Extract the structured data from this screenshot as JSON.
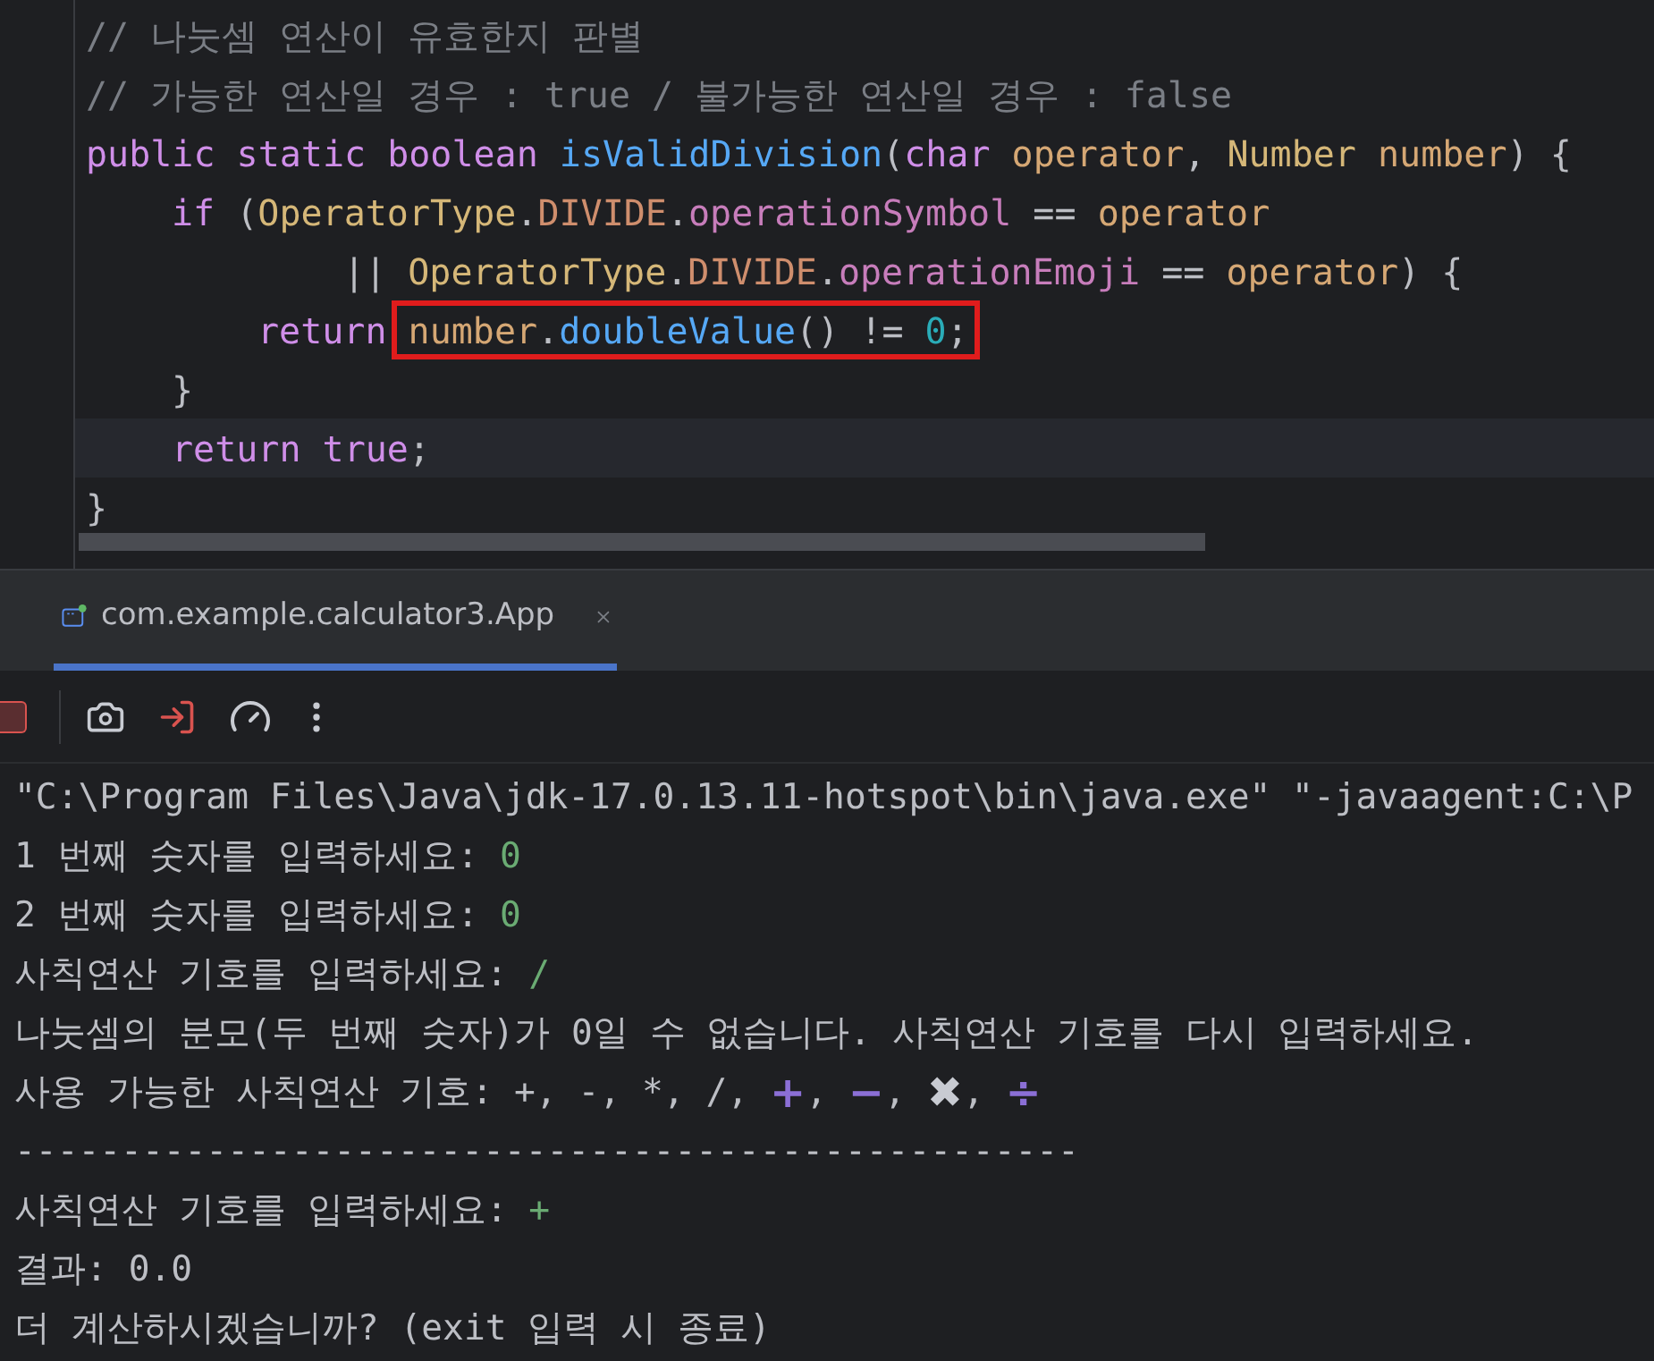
{
  "editor": {
    "lines": [
      {
        "current": false,
        "tokens": [
          {
            "text": "// 나눗셈 연산이 유효한지 판별",
            "kind": "comment"
          }
        ]
      },
      {
        "current": false,
        "tokens": [
          {
            "text": "// 가능한 연산일 경우 : true / 불가능한 연산일 경우 : false",
            "kind": "comment"
          }
        ]
      },
      {
        "current": false,
        "tokens": [
          {
            "text": "public static boolean ",
            "kind": "keyword"
          },
          {
            "text": "isValidDivision",
            "kind": "function"
          },
          {
            "text": "(",
            "kind": "plain"
          },
          {
            "text": "char ",
            "kind": "keyword"
          },
          {
            "text": "operator",
            "kind": "param"
          },
          {
            "text": ", ",
            "kind": "plain"
          },
          {
            "text": "Number ",
            "kind": "type"
          },
          {
            "text": "number",
            "kind": "param"
          },
          {
            "text": ") {",
            "kind": "plain"
          }
        ],
        "children": [
          {
            "current": false,
            "tokens": [
              {
                "text": "if ",
                "kind": "keyword"
              },
              {
                "text": "(",
                "kind": "plain"
              },
              {
                "text": "OperatorType",
                "kind": "type"
              },
              {
                "text": ".",
                "kind": "plain"
              },
              {
                "text": "DIVIDE",
                "kind": "constant"
              },
              {
                "text": ".",
                "kind": "plain"
              },
              {
                "text": "operationSymbol",
                "kind": "field"
              },
              {
                "text": " == ",
                "kind": "plain"
              },
              {
                "text": "operator",
                "kind": "param"
              }
            ],
            "children": [
              {
                "current": false,
                "continuation": true,
                "tokens": [
                  {
                    "text": "|| ",
                    "kind": "plain"
                  },
                  {
                    "text": "OperatorType",
                    "kind": "type"
                  },
                  {
                    "text": ".",
                    "kind": "plain"
                  },
                  {
                    "text": "DIVIDE",
                    "kind": "constant"
                  },
                  {
                    "text": ".",
                    "kind": "plain"
                  },
                  {
                    "text": "operationEmoji",
                    "kind": "field"
                  },
                  {
                    "text": " == ",
                    "kind": "plain"
                  },
                  {
                    "text": "operator",
                    "kind": "param"
                  },
                  {
                    "text": ") {",
                    "kind": "plain"
                  }
                ]
              },
              {
                "current": false,
                "continuation": false,
                "tokens": [
                  {
                    "text": "return ",
                    "kind": "keyword"
                  }
                ],
                "highlight_box": [
                  {
                    "text": "number",
                    "kind": "param"
                  },
                  {
                    "text": ".",
                    "kind": "plain"
                  },
                  {
                    "text": "doubleValue",
                    "kind": "function"
                  },
                  {
                    "text": "() != ",
                    "kind": "plain"
                  },
                  {
                    "text": "0",
                    "kind": "number"
                  },
                  {
                    "text": ";",
                    "kind": "plain"
                  }
                ]
              }
            ]
          },
          {
            "current": false,
            "tokens": [
              {
                "text": "}",
                "kind": "plain"
              }
            ]
          },
          {
            "current": true,
            "tokens": [
              {
                "text": "return ",
                "kind": "keyword"
              },
              {
                "text": "true",
                "kind": "keyword"
              },
              {
                "text": ";",
                "kind": "plain"
              }
            ]
          }
        ]
      },
      {
        "current": false,
        "tokens": [
          {
            "text": "}",
            "kind": "plain"
          }
        ]
      }
    ]
  },
  "run_tabs": [
    {
      "label": "com.example.calculator3.App",
      "selected": true
    }
  ],
  "console": {
    "lines": [
      {
        "tokens": [
          {
            "text": "\"C:\\Program Files\\Java\\jdk-17.0.13.11-hotspot\\bin\\java.exe\" \"-javaagent:C:\\P",
            "kind": "output"
          }
        ]
      },
      {
        "tokens": [
          {
            "text": "1 번째 숫자를 입력하세요: ",
            "kind": "output"
          },
          {
            "text": "0",
            "kind": "input"
          }
        ]
      },
      {
        "tokens": [
          {
            "text": "2 번째 숫자를 입력하세요: ",
            "kind": "output"
          },
          {
            "text": "0",
            "kind": "input"
          }
        ]
      },
      {
        "tokens": [
          {
            "text": "사칙연산 기호를 입력하세요: ",
            "kind": "output"
          },
          {
            "text": "/",
            "kind": "input"
          }
        ]
      },
      {
        "tokens": [
          {
            "text": "나눗셈의 분모(두 번째 숫자)가 0일 수 없습니다. 사칙연산 기호를 다시 입력하세요.",
            "kind": "output"
          }
        ]
      },
      {
        "tokens": [
          {
            "text": "사용 가능한 사칙연산 기호: +, -, *, /, ",
            "kind": "output"
          },
          {
            "text": "+",
            "kind": "emoji",
            "color": "#8b6fd6"
          },
          {
            "text": ", ",
            "kind": "output"
          },
          {
            "text": "−",
            "kind": "emoji",
            "color": "#8b6fd6"
          },
          {
            "text": ", ",
            "kind": "output"
          },
          {
            "text": "✖",
            "kind": "emoji",
            "color": "#c8cbd2"
          },
          {
            "text": ", ",
            "kind": "output"
          },
          {
            "text": "÷",
            "kind": "emoji",
            "color": "#8b6fd6"
          }
        ]
      },
      {
        "tokens": [
          {
            "text": "--------------------------------------------------",
            "kind": "output"
          }
        ]
      },
      {
        "tokens": [
          {
            "text": "사칙연산 기호를 입력하세요: ",
            "kind": "output"
          },
          {
            "text": "+",
            "kind": "input"
          }
        ]
      },
      {
        "tokens": [
          {
            "text": "결과: 0.0",
            "kind": "output"
          }
        ]
      },
      {
        "tokens": [
          {
            "text": "더 계산하시겠습니까? (exit 입력 시 종료)",
            "kind": "output"
          }
        ]
      }
    ]
  }
}
